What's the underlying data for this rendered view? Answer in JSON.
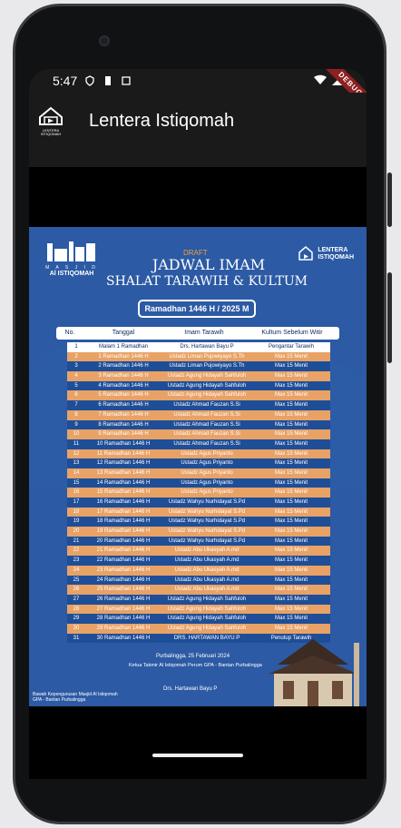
{
  "status_bar": {
    "time": "5:47"
  },
  "debug_ribbon": "DEBUG",
  "app_bar": {
    "title": "Lentera Istiqomah"
  },
  "poster": {
    "draft_label": "DRAFT",
    "title_line1": "JADWAL IMAM",
    "title_line2": "SHALAT TARAWIH & KULTUM",
    "period": "Ramadhan 1446 H / 2025 M",
    "masjid_logo": {
      "sub": "M A S J I D",
      "name": "Al ISTIQOMAH"
    },
    "lentera_logo": {
      "line1": "LENTERA",
      "line2": "ISTIQOMAH"
    },
    "table_headers": [
      "No.",
      "Tanggal",
      "Imam Tarawih",
      "Kultum Sebelum Witir"
    ],
    "rows": [
      {
        "no": "1",
        "date": "Malam 1 Ramadhan",
        "imam": "Drs. Hartawan Bayu P",
        "kultum": "Pengantar Tarawih"
      },
      {
        "no": "2",
        "date": "1 Ramadhan 1446 H",
        "imam": "Ustadz Liman Pujowiyayo S.Th",
        "kultum": "Max 15 Menit"
      },
      {
        "no": "3",
        "date": "2 Ramadhan 1446 H",
        "imam": "Ustadz Liman Pujowiyayo S.Th",
        "kultum": "Max 15 Menit"
      },
      {
        "no": "4",
        "date": "3 Ramadhan 1446 H",
        "imam": "Ustadz Agung Hidayah Sahfuloh",
        "kultum": "Max 15 Menit"
      },
      {
        "no": "5",
        "date": "4 Ramadhan 1446 H",
        "imam": "Ustadz Agung Hidayah Sahfuloh",
        "kultum": "Max 15 Menit"
      },
      {
        "no": "6",
        "date": "5 Ramadhan 1446 H",
        "imam": "Ustadz Agung Hidayah Sahfuloh",
        "kultum": "Max 15 Menit"
      },
      {
        "no": "7",
        "date": "6 Ramadhan 1446 H",
        "imam": "Ustadz Ahmad Fauzan S.Si",
        "kultum": "Max 15 Menit"
      },
      {
        "no": "8",
        "date": "7 Ramadhan 1446 H",
        "imam": "Ustadz Ahmad Fauzan S.Si",
        "kultum": "Max 15 Menit"
      },
      {
        "no": "9",
        "date": "8 Ramadhan 1446 H",
        "imam": "Ustadz Ahmad Fauzan S.Si",
        "kultum": "Max 15 Menit"
      },
      {
        "no": "10",
        "date": "9 Ramadhan 1446 H",
        "imam": "Ustadz Ahmad Fauzan S.Si",
        "kultum": "Max 15 Menit"
      },
      {
        "no": "11",
        "date": "10 Ramadhan 1446 H",
        "imam": "Ustadz Ahmad Fauzan S.Si",
        "kultum": "Max 15 Menit"
      },
      {
        "no": "12",
        "date": "11 Ramadhan 1446 H",
        "imam": "Ustadz Agus Priyanto",
        "kultum": "Max 15 Menit"
      },
      {
        "no": "13",
        "date": "12 Ramadhan 1446 H",
        "imam": "Ustadz Agus Priyanto",
        "kultum": "Max 15 Menit"
      },
      {
        "no": "14",
        "date": "13 Ramadhan 1446 H",
        "imam": "Ustadz Agus Priyanto",
        "kultum": "Max 15 Menit"
      },
      {
        "no": "15",
        "date": "14 Ramadhan 1446 H",
        "imam": "Ustadz Agus Priyanto",
        "kultum": "Max 15 Menit"
      },
      {
        "no": "16",
        "date": "15 Ramadhan 1446 H",
        "imam": "Ustadz Agus Priyanto",
        "kultum": "Max 15 Menit"
      },
      {
        "no": "17",
        "date": "16 Ramadhan 1446 H",
        "imam": "Ustadz Wahyu Nurhidayat S.Pd",
        "kultum": "Max 15 Menit"
      },
      {
        "no": "18",
        "date": "17 Ramadhan 1446 H",
        "imam": "Ustadz Wahyu Nurhidayat S.Pd",
        "kultum": "Max 15 Menit"
      },
      {
        "no": "19",
        "date": "18 Ramadhan 1446 H",
        "imam": "Ustadz Wahyu Nurhidayat S.Pd",
        "kultum": "Max 15 Menit"
      },
      {
        "no": "20",
        "date": "19 Ramadhan 1446 H",
        "imam": "Ustadz Wahyu Nurhidayat S.Pd",
        "kultum": "Max 15 Menit"
      },
      {
        "no": "21",
        "date": "20 Ramadhan 1446 H",
        "imam": "Ustadz Wahyu Nurhidayat S.Pd",
        "kultum": "Max 15 Menit"
      },
      {
        "no": "22",
        "date": "21 Ramadhan 1446 H",
        "imam": "Ustadz Abu Ukasyah A.md",
        "kultum": "Max 15 Menit"
      },
      {
        "no": "23",
        "date": "22 Ramadhan 1446 H",
        "imam": "Ustadz Abu Ukasyah A.md",
        "kultum": "Max 15 Menit"
      },
      {
        "no": "24",
        "date": "23 Ramadhan 1446 H",
        "imam": "Ustadz Abu Ukasyah A.md",
        "kultum": "Max 15 Menit"
      },
      {
        "no": "25",
        "date": "24 Ramadhan 1446 H",
        "imam": "Ustadz Abu Ukasyah A.md",
        "kultum": "Max 15 Menit"
      },
      {
        "no": "26",
        "date": "25 Ramadhan 1446 H",
        "imam": "Ustadz Abu Ukasyah A.md",
        "kultum": "Max 15 Menit"
      },
      {
        "no": "27",
        "date": "26 Ramadhan 1446 H",
        "imam": "Ustadz Agung Hidayah Sahfuloh",
        "kultum": "Max 15 Menit"
      },
      {
        "no": "28",
        "date": "27 Ramadhan 1446 H",
        "imam": "Ustadz Agung Hidayah Sahfuloh",
        "kultum": "Max 15 Menit"
      },
      {
        "no": "29",
        "date": "28 Ramadhan 1446 H",
        "imam": "Ustadz Agung Hidayah Sahfuloh",
        "kultum": "Max 15 Menit"
      },
      {
        "no": "30",
        "date": "29 Ramadhan 1446 H",
        "imam": "Ustadz Agung Hidayah Sahfuloh",
        "kultum": "Max 15 Menit"
      },
      {
        "no": "31",
        "date": "30 Ramadhan 1446 H",
        "imam": "DRS. HARTAWAN BAYU P",
        "kultum": "Penutup Tarawih"
      }
    ],
    "sign_date": "Purbalingga, 25 Februari 2024",
    "sign_org": "Ketua Takmir Al Istiqomah Perum GPA - Bantan Purbalingga",
    "sign_name": "Drs. Hartawan Bayu P",
    "address": [
      "Bawah Kepengurusan Masjid Al Istiqomah",
      "GPA - Bantan Purbalingga"
    ]
  },
  "colors": {
    "poster_blue": "#2c5aa4",
    "row_orange": "#e8a266",
    "row_blue": "#1e4e98",
    "title_orange": "#f0a23f",
    "debug_red": "#8e2020"
  }
}
